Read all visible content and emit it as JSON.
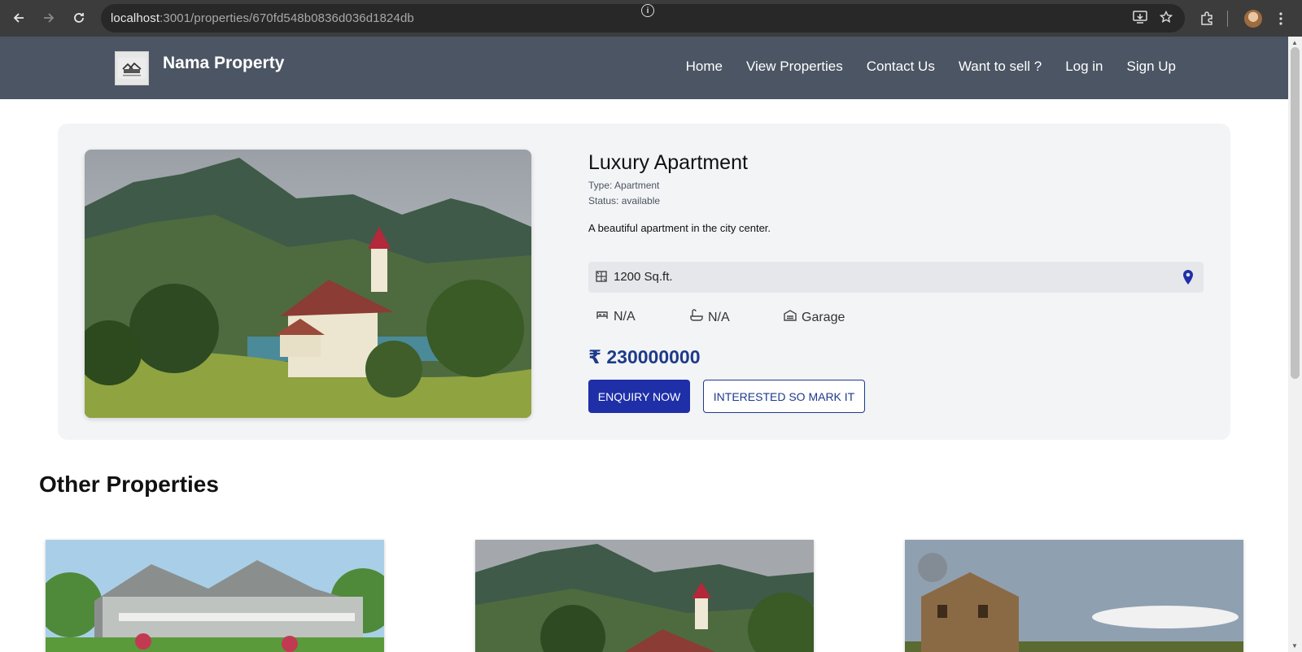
{
  "browser": {
    "url_host": "localhost",
    "url_path": ":3001/properties/670fd548b0836d036d1824db"
  },
  "header": {
    "brand": "Nama Property",
    "nav": [
      {
        "label": "Home"
      },
      {
        "label": "View Properties"
      },
      {
        "label": "Contact Us"
      },
      {
        "label": "Want to sell ?"
      },
      {
        "label": "Log in"
      },
      {
        "label": "Sign Up"
      }
    ]
  },
  "property": {
    "title": "Luxury Apartment",
    "type": "Type: Apartment",
    "status": "Status: available",
    "description": "A beautiful apartment in the city center.",
    "area": "1200 Sq.ft.",
    "bedrooms": "N/A",
    "bathrooms": "N/A",
    "parking": "Garage",
    "price": "₹ 230000000",
    "enquiry_label": "ENQUIRY NOW",
    "interested_label": "INTERESTED SO MARK IT"
  },
  "other": {
    "heading": "Other Properties"
  },
  "colors": {
    "header_bg": "#4b5563",
    "primary": "#1e2fa8",
    "price": "#1e3a8a",
    "card_bg": "#f3f4f6"
  }
}
